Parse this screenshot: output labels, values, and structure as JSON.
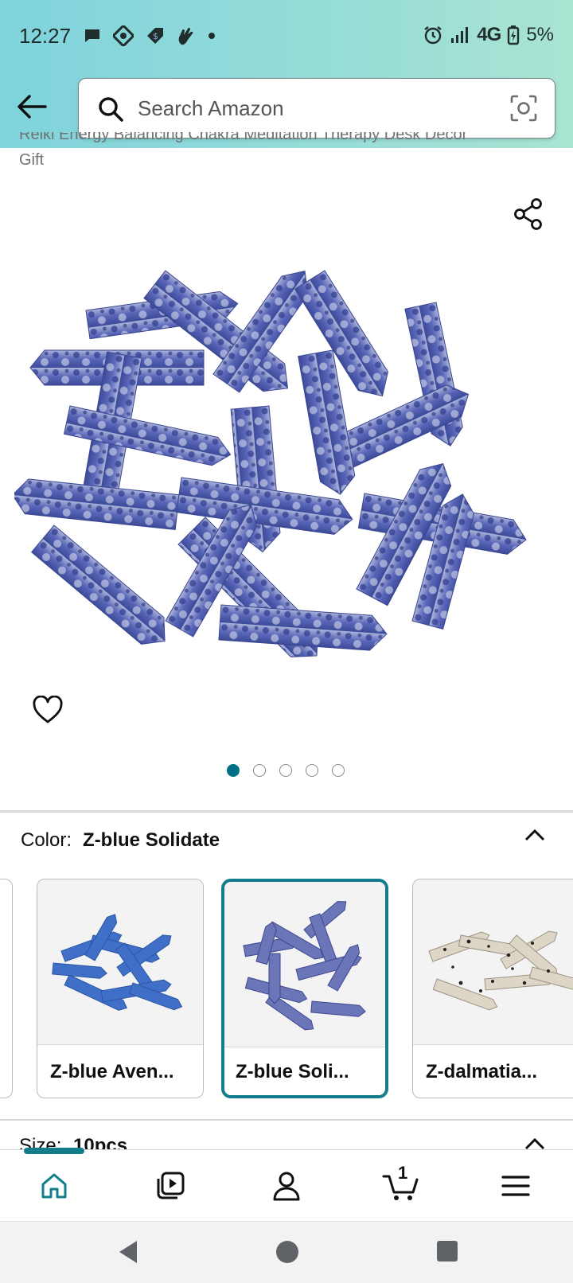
{
  "status_bar": {
    "time": "12:27",
    "network": "4G",
    "battery": "5%"
  },
  "header": {
    "search_placeholder": "Search Amazon"
  },
  "product": {
    "title_partial_line": "Reiki Energy Balancing Chakra Meditation Therapy Desk Decor",
    "title_last_line": "Gift",
    "carousel": {
      "count": 5,
      "active_index": 0
    }
  },
  "color_selector": {
    "label": "Color:",
    "selected_value": "Z-blue Solidate",
    "options": [
      {
        "name": "Z-blue Aven...",
        "selected": false
      },
      {
        "name": "Z-blue Soli...",
        "selected": true
      },
      {
        "name": "Z-dalmatia...",
        "selected": false
      }
    ]
  },
  "size_selector": {
    "label": "Size:",
    "value": "10pcs"
  },
  "bottom_nav": {
    "items": [
      "home",
      "video",
      "account",
      "cart",
      "menu"
    ],
    "active": "home",
    "cart_count": "1"
  },
  "colors": {
    "accent": "#127d8b",
    "active_dot": "#007185"
  }
}
